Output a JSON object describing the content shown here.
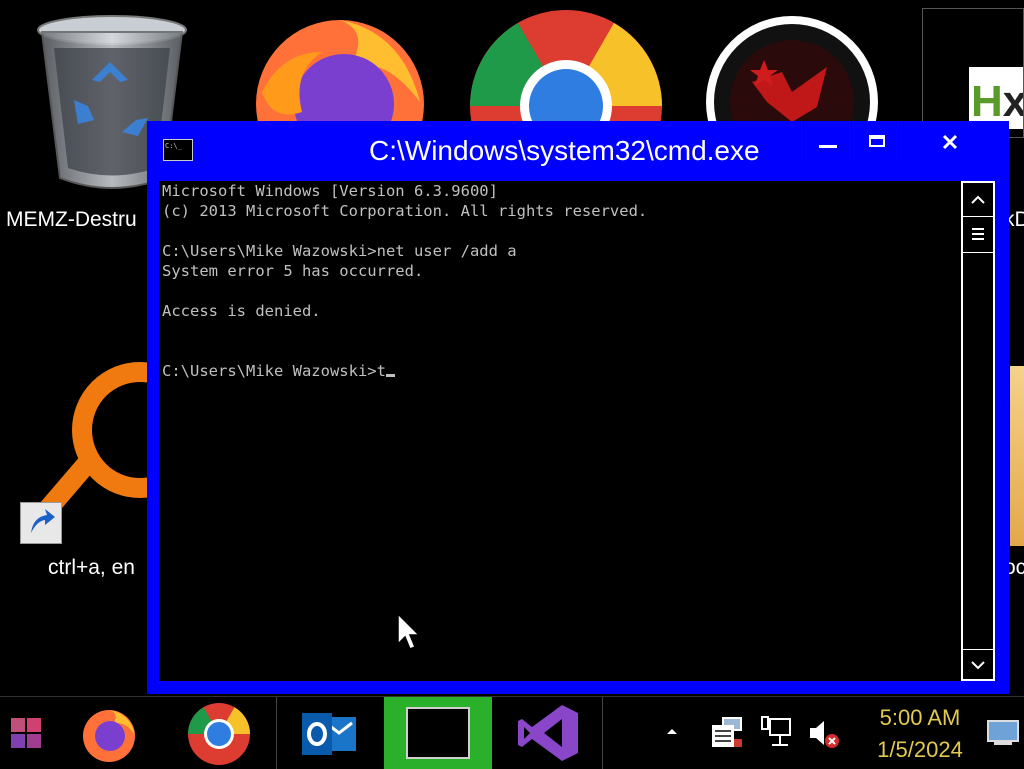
{
  "desktop": {
    "icons": [
      {
        "name": "recycle-bin",
        "label": "MEMZ-Destru"
      },
      {
        "name": "firefox",
        "label": ""
      },
      {
        "name": "chrome",
        "label": ""
      },
      {
        "name": "red-emblem",
        "label": ""
      },
      {
        "name": "hxd",
        "label": "kD"
      },
      {
        "name": "search-tool",
        "label": "ctrl+a, en"
      },
      {
        "name": "folder-partial",
        "label": "oc"
      }
    ]
  },
  "cmd_window": {
    "title": "C:\\Windows\\system32\\cmd.exe",
    "icon_text": "C:\\_",
    "lines": [
      "Microsoft Windows [Version 6.3.9600]",
      "(c) 2013 Microsoft Corporation. All rights reserved.",
      "",
      "C:\\Users\\Mike Wazowski>net user /add a",
      "System error 5 has occurred.",
      "",
      "Access is denied.",
      "",
      ""
    ],
    "prompt": "C:\\Users\\Mike Wazowski>",
    "current_input": "t",
    "accent": "#0000ff"
  },
  "taskbar": {
    "items": [
      "start-button",
      "firefox-task",
      "chrome-task",
      "outlook-task",
      "cmd-task",
      "visual-studio-task"
    ],
    "active": "cmd-task",
    "tray": {
      "time": "5:00 AM",
      "date": "1/5/2024"
    }
  }
}
